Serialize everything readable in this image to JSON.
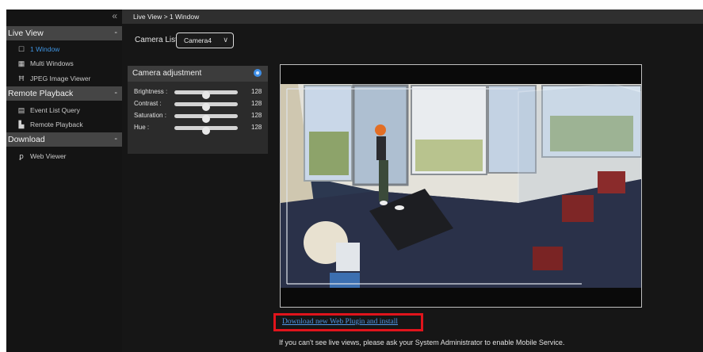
{
  "sidebar": {
    "collapse_icon": "double-chevron-left-icon",
    "sections": [
      {
        "title": "Live View",
        "items": [
          {
            "label": "1 Window",
            "icon": "single-window-icon",
            "active": true
          },
          {
            "label": "Multi Windows",
            "icon": "grid-icon",
            "active": false
          },
          {
            "label": "JPEG Image Viewer",
            "icon": "jpeg-viewer-icon",
            "active": false
          }
        ]
      },
      {
        "title": "Remote Playback",
        "items": [
          {
            "label": "Event List Query",
            "icon": "document-icon",
            "active": false
          },
          {
            "label": "Remote Playback",
            "icon": "playback-icon",
            "active": false
          }
        ]
      },
      {
        "title": "Download",
        "items": [
          {
            "label": "Web Viewer",
            "icon": "web-viewer-icon",
            "active": false
          }
        ]
      }
    ]
  },
  "breadcrumb": "Live View > 1 Window",
  "camera_list": {
    "label": "Camera List",
    "selected": "Camera4"
  },
  "camera_adjustment": {
    "title": "Camera adjustment",
    "sliders": [
      {
        "name": "Brightness :",
        "value": "128",
        "level": 0.5
      },
      {
        "name": "Contrast :",
        "value": "128",
        "level": 0.5
      },
      {
        "name": "Saturation :",
        "value": "128",
        "level": 0.5
      },
      {
        "name": "Hue :",
        "value": "128",
        "level": 0.5
      }
    ]
  },
  "plugin_link": "Download new Web Plugin and install",
  "notice": "If you can't see live views, please ask your System Administrator to enable Mobile Service.",
  "colors": {
    "accent": "#3e93e0",
    "highlight_border": "#e0141c",
    "link": "#4e97e6"
  }
}
